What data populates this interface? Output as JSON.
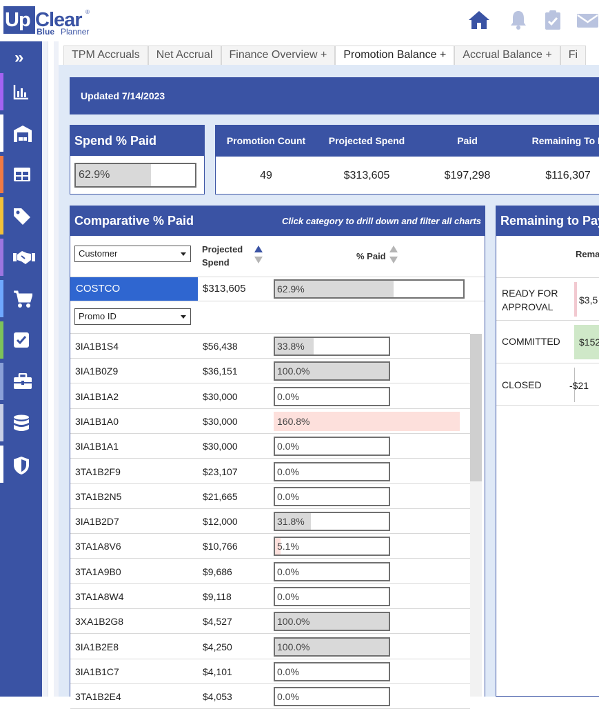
{
  "brand": {
    "up": "Up",
    "clear": "Clear",
    "reg": "®",
    "blue": "Blue",
    "planner": "Planner"
  },
  "top_icons": [
    "home-icon",
    "bell-icon",
    "clipboard-check-icon",
    "mail-icon"
  ],
  "nav": {
    "expand_label": "»",
    "items": [
      {
        "name": "chart-bar-icon",
        "color": "#a463f2"
      },
      {
        "name": "warehouse-icon",
        "color": "#ffffff"
      },
      {
        "name": "table-icon",
        "color": "#f07a44"
      },
      {
        "name": "tag-icon",
        "color": "#f2c13a"
      },
      {
        "name": "handshake-icon",
        "color": "#9c76e0"
      },
      {
        "name": "cart-icon",
        "color": "#6fa8ff"
      },
      {
        "name": "checkbox-icon",
        "color": "#7dc25a"
      },
      {
        "name": "briefcase-icon",
        "color": "#8aa0d8"
      },
      {
        "name": "database-icon",
        "color": "#c8cfe6"
      },
      {
        "name": "shield-icon",
        "color": "#ffffff"
      }
    ]
  },
  "tabs": [
    {
      "label": "TPM Accruals",
      "active": false
    },
    {
      "label": "Net Accrual",
      "active": false
    },
    {
      "label": "Finance Overview +",
      "active": false
    },
    {
      "label": "Promotion Balance +",
      "active": true
    },
    {
      "label": "Accrual Balance +",
      "active": false
    },
    {
      "label": "Fi",
      "active": false
    }
  ],
  "banner": {
    "text": "Updated 7/14/2023"
  },
  "spend_paid": {
    "title": "Spend % Paid",
    "value_text": "62.9%",
    "fraction": 0.629
  },
  "kpis": [
    {
      "label": "Promotion Count",
      "value": "49"
    },
    {
      "label": "Projected Spend",
      "value": "$313,605"
    },
    {
      "label": "Paid",
      "value": "$197,298"
    },
    {
      "label": "Remaining To P",
      "value": "$116,307"
    }
  ],
  "comparative": {
    "title": "Comparative % Paid",
    "hint": "Click category to drill down and filter all charts",
    "category_dropdown": "Customer",
    "col_projected_1": "Projected",
    "col_projected_2": "Spend",
    "col_paid": "% Paid",
    "customer": {
      "name": "COSTCO",
      "spend": "$313,605",
      "pct_text": "62.9%",
      "fraction": 0.629
    },
    "promo_dropdown": "Promo ID",
    "rows": [
      {
        "id": "3IA1B1S4",
        "spend": "$56,438",
        "pct_text": "33.8%",
        "fraction": 0.338
      },
      {
        "id": "3IA1B0Z9",
        "spend": "$36,151",
        "pct_text": "100.0%",
        "fraction": 1.0
      },
      {
        "id": "3IA1B1A2",
        "spend": "$30,000",
        "pct_text": "0.0%",
        "fraction": 0.0
      },
      {
        "id": "3IA1B1A0",
        "spend": "$30,000",
        "pct_text": "160.8%",
        "fraction": 1.608
      },
      {
        "id": "3IA1B1A1",
        "spend": "$30,000",
        "pct_text": "0.0%",
        "fraction": 0.0
      },
      {
        "id": "3TA1B2F9",
        "spend": "$23,107",
        "pct_text": "0.0%",
        "fraction": 0.0
      },
      {
        "id": "3TA1B2N5",
        "spend": "$21,665",
        "pct_text": "0.0%",
        "fraction": 0.0
      },
      {
        "id": "3IA1B2D7",
        "spend": "$12,000",
        "pct_text": "31.8%",
        "fraction": 0.318
      },
      {
        "id": "3TA1A8V6",
        "spend": "$10,766",
        "pct_text": "5.1%",
        "fraction": 0.051
      },
      {
        "id": "3TA1A9B0",
        "spend": "$9,686",
        "pct_text": "0.0%",
        "fraction": 0.0
      },
      {
        "id": "3TA1A8W4",
        "spend": "$9,118",
        "pct_text": "0.0%",
        "fraction": 0.0
      },
      {
        "id": "3XA1B2G8",
        "spend": "$4,527",
        "pct_text": "100.0%",
        "fraction": 1.0
      },
      {
        "id": "3IA1B2E8",
        "spend": "$4,250",
        "pct_text": "100.0%",
        "fraction": 1.0
      },
      {
        "id": "3IA1B1C7",
        "spend": "$4,101",
        "pct_text": "0.0%",
        "fraction": 0.0
      },
      {
        "id": "3TA1B2E4",
        "spend": "$4,053",
        "pct_text": "0.0%",
        "fraction": 0.0
      }
    ]
  },
  "remaining": {
    "title": "Remaining to Pay",
    "col_label": "Rema",
    "rows": [
      {
        "label_1": "READY FOR",
        "label_2": "APPROVAL",
        "value": "$3,5",
        "bar_color": "#f2c9d0"
      },
      {
        "label_1": "COMMITTED",
        "label_2": "",
        "value": "$152",
        "bar_color": "#cfe8c8"
      },
      {
        "label_1": "CLOSED",
        "label_2": "",
        "value": "-$21",
        "bar_color": "#e6e6e6"
      }
    ]
  },
  "colors": {
    "brand": "#3a53a4",
    "selected": "#2f66d0",
    "bar_fill": "#d9d9d9",
    "over_fill": "#fde0dc"
  }
}
